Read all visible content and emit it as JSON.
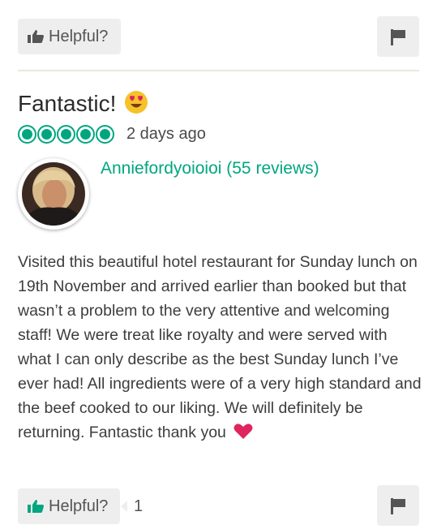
{
  "top_actions": {
    "helpful_label": "Helpful?",
    "thumb_icon": "thumbs-up-icon",
    "flag_icon": "flag-icon"
  },
  "review": {
    "title": "Fantastic!",
    "title_emoji": "heart-eyes-emoji",
    "rating": 5,
    "rating_max": 5,
    "date": "2 days ago",
    "author": "Anniefordyoioioi (55 reviews)",
    "body": "Visited this beautiful hotel restaurant for Sunday lunch on 19th November and arrived earlier than booked but that wasn’t a problem to the very attentive and welcoming staff! We were treat like royalty and were served with what I can only describe as the best Sunday lunch I’ve ever had! All ingredients were of a very high standard and the beef cooked to our liking. We will definitely be returning. Fantastic thank you",
    "body_end_emoji": "red-heart-emoji"
  },
  "bottom_actions": {
    "helpful_label": "Helpful?",
    "helpful_count": "1",
    "thumb_icon": "thumbs-up-icon",
    "flag_icon": "flag-icon"
  },
  "colors": {
    "brand_green": "#00a680",
    "button_bg": "#eeeeee",
    "divider": "#ece8d8"
  }
}
